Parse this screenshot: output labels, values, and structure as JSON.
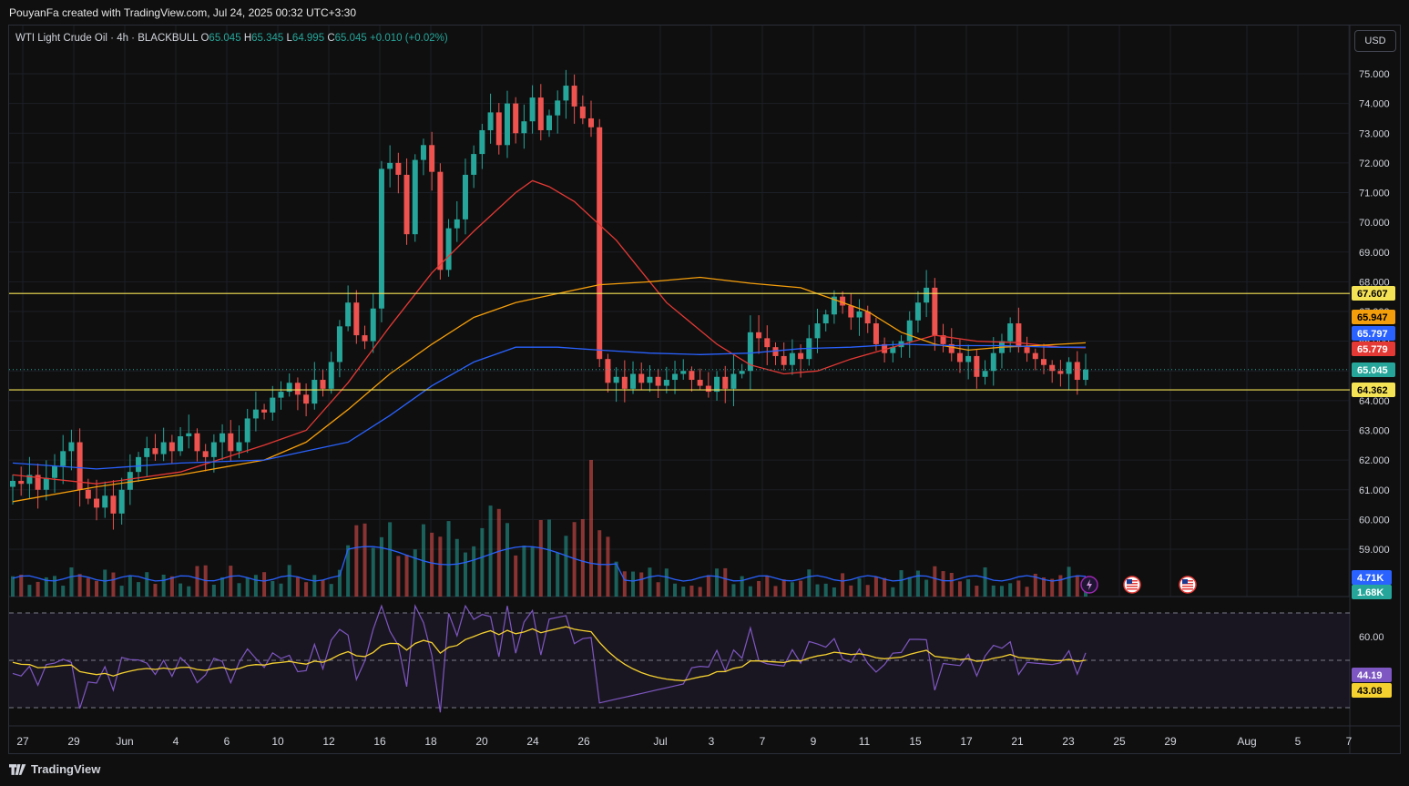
{
  "header": {
    "attribution": "PouyanFa created with TradingView.com, Jul 24, 2025 00:32 UTC+3:30"
  },
  "legend": {
    "symbol": "WTI Light Crude Oil · 4h · BLACKBULL",
    "o_label": "O",
    "o_value": "65.045",
    "h_label": "H",
    "h_value": "65.345",
    "l_label": "L",
    "l_value": "64.995",
    "c_label": "C",
    "c_value": "65.045",
    "change": "+0.010 (+0.02%)"
  },
  "currency_button": "USD",
  "branding": "TradingView",
  "colors": {
    "up": "#26a69a",
    "down": "#ef5350",
    "ma_red": "#e53935",
    "ma_orange": "#f59e0b",
    "ma_blue": "#2962ff",
    "hline": "#f5e356",
    "rsi": "#7e57c2",
    "rsi_ma": "#f5d130"
  },
  "icons": [
    "lightning-icon",
    "us-flag-icon",
    "us-flag-icon"
  ],
  "chart_data": {
    "type": "candlestick",
    "price_axis": [
      "75.000",
      "74.000",
      "73.000",
      "72.000",
      "71.000",
      "70.000",
      "69.000",
      "68.000",
      "67.000",
      "66.000",
      "65.000",
      "64.000",
      "63.000",
      "62.000",
      "61.000",
      "60.000",
      "59.000"
    ],
    "ylim": [
      58.5,
      75.5
    ],
    "x_ticks": [
      "27",
      "29",
      "Jun",
      "4",
      "6",
      "10",
      "12",
      "16",
      "18",
      "20",
      "24",
      "26",
      "Jul",
      "3",
      "7",
      "9",
      "11",
      "15",
      "17",
      "21",
      "23",
      "25",
      "29",
      "Aug",
      "5",
      "7"
    ],
    "horizontal_levels": [
      67.607,
      64.362
    ],
    "price_labels": [
      {
        "text": "67.607",
        "value": 67.607,
        "bg": "#f5e356",
        "fg": "#000000"
      },
      {
        "text": "65.947",
        "value": 65.947,
        "bg": "#f59e0b",
        "fg": "#000000"
      },
      {
        "text": "65.797",
        "value": 65.797,
        "bg": "#2962ff",
        "fg": "#ffffff"
      },
      {
        "text": "65.779",
        "value": 65.779,
        "bg": "#e53935",
        "fg": "#ffffff"
      },
      {
        "text": "65.045",
        "value": 65.045,
        "bg": "#26a69a",
        "fg": "#ffffff"
      },
      {
        "text": "64.362",
        "value": 64.362,
        "bg": "#f5e356",
        "fg": "#000000"
      }
    ],
    "close_path": [
      [
        0,
        61.3
      ],
      [
        1,
        61.2
      ],
      [
        2,
        61.5
      ],
      [
        3,
        61.0
      ],
      [
        4,
        61.4
      ],
      [
        5,
        61.8
      ],
      [
        6,
        62.3
      ],
      [
        7,
        62.6
      ],
      [
        8,
        61.0
      ],
      [
        9,
        60.7
      ],
      [
        10,
        60.4
      ],
      [
        11,
        60.8
      ],
      [
        12,
        60.2
      ],
      [
        13,
        61.0
      ],
      [
        14,
        61.6
      ],
      [
        15,
        62.1
      ],
      [
        16,
        62.4
      ],
      [
        17,
        62.2
      ],
      [
        18,
        62.6
      ],
      [
        19,
        62.3
      ],
      [
        20,
        62.8
      ],
      [
        21,
        62.9
      ],
      [
        22,
        62.3
      ],
      [
        23,
        62.1
      ],
      [
        24,
        62.6
      ],
      [
        25,
        62.9
      ],
      [
        26,
        62.3
      ],
      [
        27,
        62.6
      ],
      [
        28,
        63.4
      ],
      [
        29,
        63.7
      ],
      [
        30,
        63.6
      ],
      [
        31,
        64.1
      ],
      [
        32,
        64.3
      ],
      [
        33,
        64.6
      ],
      [
        34,
        64.2
      ],
      [
        35,
        63.9
      ],
      [
        36,
        64.7
      ],
      [
        37,
        64.4
      ],
      [
        38,
        65.3
      ],
      [
        39,
        66.5
      ],
      [
        40,
        67.3
      ],
      [
        41,
        66.2
      ],
      [
        42,
        66.0
      ],
      [
        43,
        67.1
      ],
      [
        44,
        71.8
      ],
      [
        45,
        72.0
      ],
      [
        46,
        71.6
      ],
      [
        47,
        69.6
      ],
      [
        48,
        72.1
      ],
      [
        49,
        72.6
      ],
      [
        50,
        71.7
      ],
      [
        51,
        68.4
      ],
      [
        52,
        69.8
      ],
      [
        53,
        70.1
      ],
      [
        54,
        71.6
      ],
      [
        55,
        72.3
      ],
      [
        56,
        73.1
      ],
      [
        57,
        73.7
      ],
      [
        58,
        72.6
      ],
      [
        59,
        74.0
      ],
      [
        60,
        73.0
      ],
      [
        61,
        73.4
      ],
      [
        62,
        74.2
      ],
      [
        63,
        73.1
      ],
      [
        64,
        73.6
      ],
      [
        65,
        74.1
      ],
      [
        66,
        74.6
      ],
      [
        67,
        73.9
      ],
      [
        68,
        73.5
      ],
      [
        69,
        73.2
      ],
      [
        70,
        65.4
      ],
      [
        71,
        64.6
      ],
      [
        72,
        64.8
      ],
      [
        73,
        64.4
      ],
      [
        74,
        64.9
      ],
      [
        75,
        64.6
      ],
      [
        76,
        64.8
      ],
      [
        77,
        64.5
      ],
      [
        78,
        64.7
      ],
      [
        79,
        64.9
      ],
      [
        80,
        65.0
      ],
      [
        81,
        64.7
      ],
      [
        82,
        64.5
      ],
      [
        83,
        64.3
      ],
      [
        84,
        64.8
      ],
      [
        85,
        64.4
      ],
      [
        86,
        64.9
      ],
      [
        87,
        65.0
      ],
      [
        88,
        66.3
      ],
      [
        89,
        66.1
      ],
      [
        90,
        65.8
      ],
      [
        91,
        65.5
      ],
      [
        92,
        65.2
      ],
      [
        93,
        65.6
      ],
      [
        94,
        65.4
      ],
      [
        95,
        66.1
      ],
      [
        96,
        66.6
      ],
      [
        97,
        66.9
      ],
      [
        98,
        67.5
      ],
      [
        99,
        67.2
      ],
      [
        100,
        66.8
      ],
      [
        101,
        67.0
      ],
      [
        102,
        66.6
      ],
      [
        103,
        65.9
      ],
      [
        104,
        65.6
      ],
      [
        105,
        65.8
      ],
      [
        106,
        66.0
      ],
      [
        107,
        66.7
      ],
      [
        108,
        67.3
      ],
      [
        109,
        67.8
      ],
      [
        110,
        66.2
      ],
      [
        111,
        65.9
      ],
      [
        112,
        65.6
      ],
      [
        113,
        65.3
      ],
      [
        114,
        65.5
      ],
      [
        115,
        64.8
      ],
      [
        116,
        65.0
      ],
      [
        117,
        65.6
      ],
      [
        118,
        66.0
      ],
      [
        119,
        66.6
      ],
      [
        120,
        65.8
      ],
      [
        121,
        65.6
      ],
      [
        122,
        65.4
      ],
      [
        123,
        65.2
      ],
      [
        124,
        65.0
      ],
      [
        125,
        64.9
      ],
      [
        126,
        65.3
      ],
      [
        127,
        64.7
      ],
      [
        128,
        65.045
      ]
    ],
    "ma_red": [
      [
        0,
        61.5
      ],
      [
        10,
        61.2
      ],
      [
        20,
        61.6
      ],
      [
        30,
        62.5
      ],
      [
        35,
        63.0
      ],
      [
        40,
        64.6
      ],
      [
        45,
        66.5
      ],
      [
        50,
        68.3
      ],
      [
        55,
        69.7
      ],
      [
        60,
        71.0
      ],
      [
        62,
        71.4
      ],
      [
        64,
        71.2
      ],
      [
        67,
        70.7
      ],
      [
        72,
        69.4
      ],
      [
        78,
        67.3
      ],
      [
        84,
        65.9
      ],
      [
        88,
        65.2
      ],
      [
        92,
        64.9
      ],
      [
        96,
        65.0
      ],
      [
        100,
        65.4
      ],
      [
        105,
        65.8
      ],
      [
        110,
        66.2
      ],
      [
        115,
        66.0
      ],
      [
        120,
        65.95
      ],
      [
        125,
        65.8
      ],
      [
        128,
        65.779
      ]
    ],
    "ma_orange": [
      [
        0,
        60.6
      ],
      [
        10,
        61.1
      ],
      [
        20,
        61.5
      ],
      [
        30,
        62.0
      ],
      [
        35,
        62.6
      ],
      [
        40,
        63.7
      ],
      [
        45,
        64.9
      ],
      [
        50,
        65.9
      ],
      [
        55,
        66.8
      ],
      [
        60,
        67.3
      ],
      [
        65,
        67.6
      ],
      [
        70,
        67.9
      ],
      [
        76,
        68.0
      ],
      [
        82,
        68.15
      ],
      [
        88,
        67.95
      ],
      [
        94,
        67.8
      ],
      [
        98,
        67.4
      ],
      [
        102,
        67.0
      ],
      [
        106,
        66.3
      ],
      [
        110,
        65.9
      ],
      [
        114,
        65.7
      ],
      [
        118,
        65.8
      ],
      [
        122,
        65.85
      ],
      [
        128,
        65.947
      ]
    ],
    "ma_blue": [
      [
        0,
        61.9
      ],
      [
        10,
        61.7
      ],
      [
        20,
        61.9
      ],
      [
        30,
        62.0
      ],
      [
        35,
        62.3
      ],
      [
        40,
        62.6
      ],
      [
        45,
        63.5
      ],
      [
        50,
        64.5
      ],
      [
        55,
        65.3
      ],
      [
        60,
        65.8
      ],
      [
        65,
        65.8
      ],
      [
        70,
        65.7
      ],
      [
        76,
        65.6
      ],
      [
        82,
        65.55
      ],
      [
        88,
        65.6
      ],
      [
        94,
        65.75
      ],
      [
        100,
        65.8
      ],
      [
        106,
        65.9
      ],
      [
        112,
        65.85
      ],
      [
        118,
        65.85
      ],
      [
        124,
        65.8
      ],
      [
        128,
        65.797
      ]
    ],
    "volume_labels": [
      {
        "text": "4.71K",
        "bg": "#2962ff",
        "fg": "#ffffff"
      },
      {
        "text": "1.68K",
        "bg": "#26a69a",
        "fg": "#ffffff"
      }
    ],
    "rsi_axis": [
      "60.00"
    ],
    "rsi_values": [
      {
        "text": "44.19",
        "bg": "#7e57c2",
        "fg": "#ffffff"
      },
      {
        "text": "43.08",
        "bg": "#f5d130",
        "fg": "#000000"
      }
    ],
    "rsi_levels": [
      70,
      50,
      30
    ]
  }
}
